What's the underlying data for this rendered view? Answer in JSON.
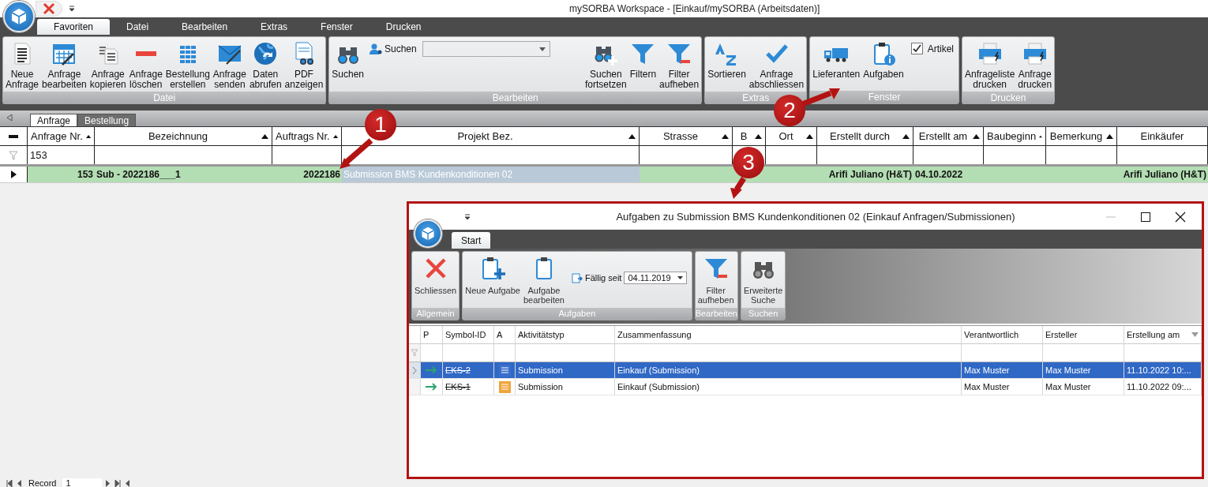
{
  "window": {
    "title": "mySORBA Workspace - [Einkauf/mySORBA (Arbeitsdaten)]"
  },
  "ribbon_tabs": [
    {
      "label": "Favoriten",
      "selected": true
    },
    {
      "label": "Datei",
      "selected": false
    },
    {
      "label": "Bearbeiten",
      "selected": false
    },
    {
      "label": "Extras",
      "selected": false
    },
    {
      "label": "Fenster",
      "selected": false
    },
    {
      "label": "Drucken",
      "selected": false
    }
  ],
  "ribbon_groups": [
    {
      "label": "Datei",
      "items": [
        {
          "kind": "button",
          "label": "Neue\nAnfrage"
        },
        {
          "kind": "button",
          "label": "Anfrage\nbearbeiten"
        },
        {
          "kind": "button",
          "label": "Anfrage\nkopieren"
        },
        {
          "kind": "button",
          "label": "Anfrage\nlöschen"
        },
        {
          "kind": "button",
          "label": "Bestellung\nerstellen"
        },
        {
          "kind": "button",
          "label": "Anfrage\nsenden"
        },
        {
          "kind": "button",
          "label": "Daten\nabrufen"
        },
        {
          "kind": "button",
          "label": "PDF\nanzeigen"
        }
      ]
    },
    {
      "label": "Bearbeiten",
      "items": [
        {
          "kind": "button",
          "label": "Suchen"
        },
        {
          "kind": "search",
          "label": "Suchen"
        },
        {
          "kind": "button",
          "label": "Suchen\nfortsetzen"
        },
        {
          "kind": "button",
          "label": "Filtern"
        },
        {
          "kind": "button",
          "label": "Filter\naufheben"
        }
      ]
    },
    {
      "label": "Extras",
      "items": [
        {
          "kind": "button",
          "label": "Sortieren"
        },
        {
          "kind": "button",
          "label": "Anfrage\nabschliessen"
        }
      ]
    },
    {
      "label": "Fenster",
      "items": [
        {
          "kind": "button",
          "label": "Lieferanten"
        },
        {
          "kind": "button",
          "label": "Aufgaben"
        },
        {
          "kind": "checkbox",
          "label": "Artikel",
          "checked": true
        }
      ]
    },
    {
      "label": "Drucken",
      "items": [
        {
          "kind": "button",
          "label": "Anfrageliste\ndrucken"
        },
        {
          "kind": "button",
          "label": "Anfrage\ndrucken"
        }
      ]
    }
  ],
  "document_tabs": [
    {
      "label": "Anfrage",
      "selected": true
    },
    {
      "label": "Bestellung",
      "selected": false
    }
  ],
  "grid": {
    "columns": [
      {
        "label": "Anfrage Nr.",
        "sort_arrow": true
      },
      {
        "label": "Bezeichnung",
        "sort_arrow": true
      },
      {
        "label": "Auftrags Nr.",
        "sort_arrow": true
      },
      {
        "label": "Projekt Bez.",
        "sort_arrow": true
      },
      {
        "label": "Strasse",
        "sort_arrow": true
      },
      {
        "label": "B",
        "sort_arrow": true
      },
      {
        "label": "Ort",
        "sort_arrow": true
      },
      {
        "label": "Erstellt durch",
        "sort_arrow": true
      },
      {
        "label": "Erstellt am",
        "sort_arrow": true
      },
      {
        "label": "Baubeginn",
        "sort_arrow": true
      },
      {
        "label": "Bemerkung",
        "sort_arrow": true
      },
      {
        "label": "Einkäufer",
        "sort_arrow": false
      }
    ],
    "filter_values": [
      "153"
    ],
    "rows": [
      {
        "current": true,
        "cells": [
          {
            "text": "153",
            "selected": false
          },
          {
            "text": "Sub - 2022186___1",
            "selected": false
          },
          {
            "text": "2022186",
            "selected": false
          },
          {
            "text": "Submission BMS Kundenkonditionen 02",
            "selected": true
          },
          {
            "selected": false
          },
          {
            "selected": false
          },
          {
            "selected": false
          },
          {
            "text": "Arifi Juliano (H&T)",
            "selected": false
          },
          {
            "text": "04.10.2022",
            "selected": false
          },
          {
            "selected": false
          },
          {
            "selected": false
          },
          {
            "text": "Arifi Juliano (H&T)",
            "selected": false
          }
        ]
      }
    ]
  },
  "record_navigator": {
    "label": "Record",
    "value": "1"
  },
  "dialog": {
    "title": "Aufgaben zu Submission BMS Kundenkonditionen 02 (Einkauf Anfragen/Submissionen)",
    "tabs": [
      {
        "label": "Start",
        "selected": true
      }
    ],
    "ribbon_groups": [
      {
        "label": "Allgemein",
        "items": [
          {
            "kind": "button",
            "label": "Schliessen"
          }
        ]
      },
      {
        "label": "Aufgaben",
        "items": [
          {
            "kind": "button",
            "label": "Neue Aufgabe"
          },
          {
            "kind": "button",
            "label": "Aufgabe\nbearbeiten"
          },
          {
            "kind": "date",
            "label": "Fällig seit",
            "value": "04.11.2019"
          }
        ]
      },
      {
        "label": "Bearbeiten",
        "items": [
          {
            "kind": "button",
            "label": "Filter\naufheben"
          }
        ]
      },
      {
        "label": "Suchen",
        "items": [
          {
            "kind": "button",
            "label": "Erweiterte\nSuche"
          }
        ]
      }
    ],
    "grid": {
      "columns": [
        {
          "label": "P",
          "sort_arrow": false
        },
        {
          "label": "Symbol-ID",
          "sort_arrow": false
        },
        {
          "label": "A",
          "sort_arrow": false
        },
        {
          "label": "Aktivitätstyp",
          "sort_arrow": false
        },
        {
          "label": "Zusammenfassung",
          "sort_arrow": false
        },
        {
          "label": "Verantwortlich",
          "sort_arrow": false
        },
        {
          "label": "Ersteller",
          "sort_arrow": false
        },
        {
          "label": "Erstellung am",
          "sort_arrow": true
        }
      ],
      "rows": [
        {
          "selected": true,
          "completed": true,
          "color": "#3a6fcc",
          "symbol_id": "EKS-2",
          "type": "Submission",
          "summary": "Einkauf (Submission)",
          "responsible": "Max Muster",
          "creator": "Max Muster",
          "created": "11.10.2022 10:..."
        },
        {
          "selected": false,
          "completed": true,
          "color": "#f0a53c",
          "symbol_id": "EKS-1",
          "type": "Submission",
          "summary": "Einkauf (Submission)",
          "responsible": "Max Muster",
          "creator": "Max Muster",
          "created": "11.10.2022 09:..."
        }
      ]
    }
  },
  "annotations": [
    {
      "label": "1"
    },
    {
      "label": "2"
    },
    {
      "label": "3"
    }
  ]
}
